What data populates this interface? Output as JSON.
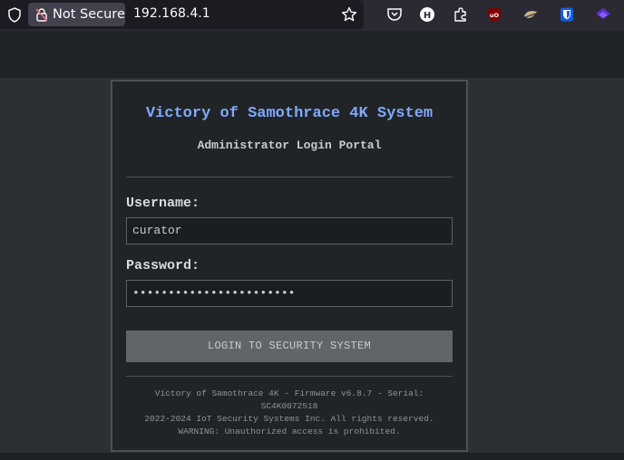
{
  "browser": {
    "security_label": "Not Secure",
    "url": "192.168.4.1",
    "icons": [
      "shield-icon",
      "insecure-lock-icon",
      "bookmark-star-icon",
      "pocket-icon",
      "hypothesis-icon",
      "extensions-icon",
      "ublock-icon",
      "fox-extension-icon",
      "bitwarden-icon",
      "layers-extension-icon"
    ]
  },
  "login": {
    "title": "Victory of Samothrace 4K System",
    "subtitle": "Administrator Login Portal",
    "username_label": "Username:",
    "username_value": "curator",
    "password_label": "Password:",
    "password_value": "•••••••••••••••••••••••",
    "submit_label": "LOGIN TO SECURITY SYSTEM"
  },
  "footer": {
    "line1": "Victory of Samothrace 4K - Firmware v6.8.7 - Serial:",
    "line2": "SC4K0072518",
    "line3": "2022-2024 IoT Security Systems Inc. All rights reserved.",
    "line4": "WARNING: Unauthorized access is prohibited."
  },
  "colors": {
    "accent": "#7fa9ff",
    "panel": "#212426",
    "button": "#5f6568",
    "page": "#2b3033"
  }
}
